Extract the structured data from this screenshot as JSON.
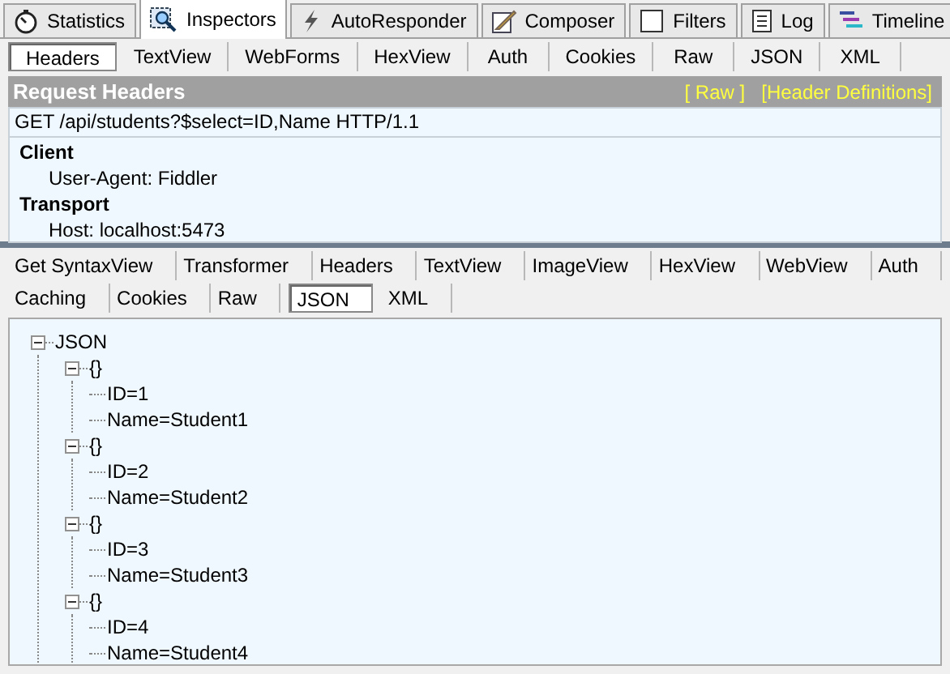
{
  "main_tabs": [
    {
      "label": "Statistics",
      "selected": false
    },
    {
      "label": "Inspectors",
      "selected": true
    },
    {
      "label": "AutoResponder",
      "selected": false
    },
    {
      "label": "Composer",
      "selected": false
    },
    {
      "label": "Filters",
      "selected": false
    },
    {
      "label": "Log",
      "selected": false
    },
    {
      "label": "Timeline",
      "selected": false
    }
  ],
  "request": {
    "tabs": [
      {
        "label": "Headers",
        "selected": true
      },
      {
        "label": "TextView",
        "selected": false
      },
      {
        "label": "WebForms",
        "selected": false
      },
      {
        "label": "HexView",
        "selected": false
      },
      {
        "label": "Auth",
        "selected": false
      },
      {
        "label": "Cookies",
        "selected": false
      },
      {
        "label": "Raw",
        "selected": false
      },
      {
        "label": "JSON",
        "selected": false
      },
      {
        "label": "XML",
        "selected": false
      }
    ],
    "title": "Request Headers",
    "links": [
      "[ Raw ]",
      "[Header Definitions]"
    ],
    "request_line": "GET /api/students?$select=ID,Name HTTP/1.1",
    "groups": [
      {
        "name": "Client",
        "headers": [
          "User-Agent: Fiddler"
        ]
      },
      {
        "name": "Transport",
        "headers": [
          "Host: localhost:5473"
        ]
      }
    ]
  },
  "response": {
    "tab_rows": [
      [
        {
          "label": "Get SyntaxView",
          "selected": false
        },
        {
          "label": "Transformer",
          "selected": false
        },
        {
          "label": "Headers",
          "selected": false
        },
        {
          "label": "TextView",
          "selected": false
        },
        {
          "label": "ImageView",
          "selected": false
        },
        {
          "label": "HexView",
          "selected": false
        },
        {
          "label": "WebView",
          "selected": false
        },
        {
          "label": "Auth",
          "selected": false
        }
      ],
      [
        {
          "label": "Caching",
          "selected": false
        },
        {
          "label": "Cookies",
          "selected": false
        },
        {
          "label": "Raw",
          "selected": false
        },
        {
          "label": "JSON",
          "selected": true
        },
        {
          "label": "XML",
          "selected": false
        }
      ]
    ],
    "tree": [
      {
        "label": "JSON",
        "expanded": true,
        "children": [
          {
            "label": "{}",
            "expanded": true,
            "children": [
              {
                "label": "ID=1"
              },
              {
                "label": "Name=Student1"
              }
            ]
          },
          {
            "label": "{}",
            "expanded": true,
            "children": [
              {
                "label": "ID=2"
              },
              {
                "label": "Name=Student2"
              }
            ]
          },
          {
            "label": "{}",
            "expanded": true,
            "children": [
              {
                "label": "ID=3"
              },
              {
                "label": "Name=Student3"
              }
            ]
          },
          {
            "label": "{}",
            "expanded": true,
            "children": [
              {
                "label": "ID=4"
              },
              {
                "label": "Name=Student4"
              }
            ]
          }
        ]
      }
    ]
  }
}
